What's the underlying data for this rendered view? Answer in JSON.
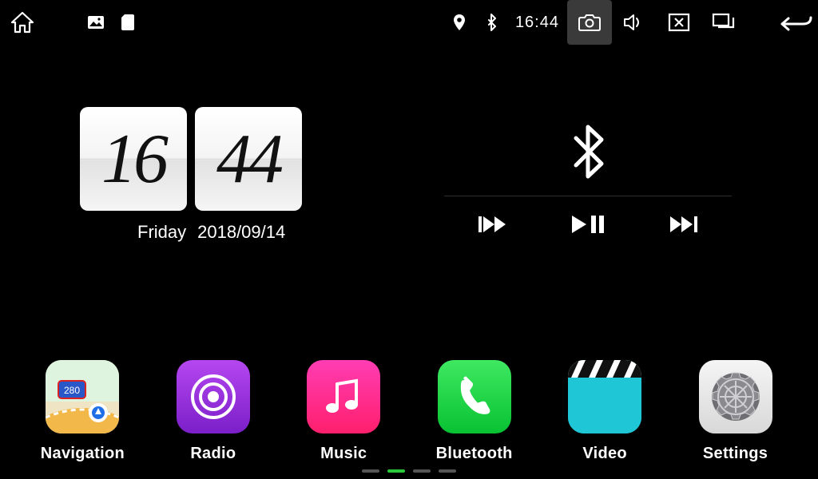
{
  "statusbar": {
    "time": "16:44"
  },
  "clock": {
    "hours": "16",
    "minutes": "44",
    "weekday": "Friday",
    "date": "2018/09/14"
  },
  "apps": {
    "navigation": {
      "label": "Navigation"
    },
    "radio": {
      "label": "Radio"
    },
    "music": {
      "label": "Music"
    },
    "bluetooth": {
      "label": "Bluetooth"
    },
    "video": {
      "label": "Video"
    },
    "settings": {
      "label": "Settings"
    }
  },
  "pager": {
    "count": 4,
    "active_index": 1
  }
}
